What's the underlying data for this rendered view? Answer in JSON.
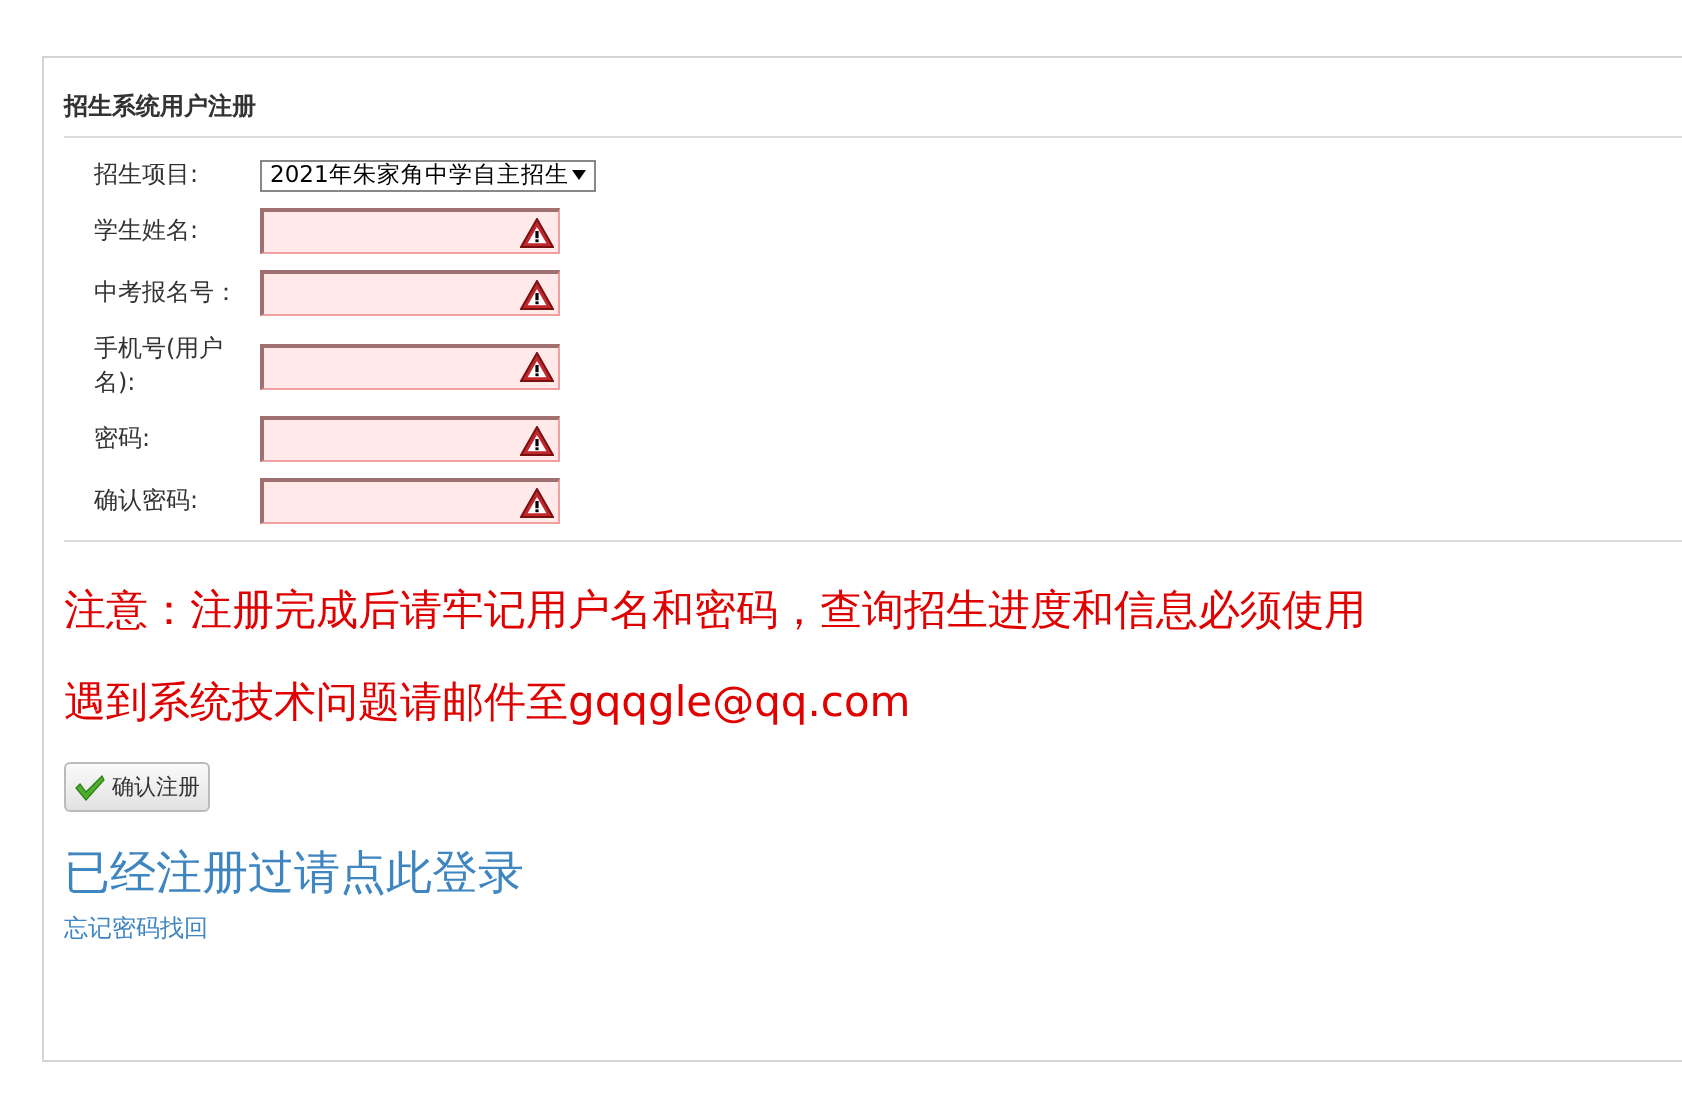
{
  "panel": {
    "title": "招生系统用户注册"
  },
  "fields": [
    {
      "label": "招生项目:",
      "kind": "select",
      "value": "2021年朱家角中学自主招生",
      "invalid": false
    },
    {
      "label": "学生姓名:",
      "kind": "text",
      "invalid": true
    },
    {
      "label": "中考报名号：",
      "kind": "text",
      "invalid": true
    },
    {
      "label": "手机号(用户名):",
      "kind": "text",
      "invalid": true
    },
    {
      "label": "密码:",
      "kind": "password",
      "invalid": true
    },
    {
      "label": "确认密码:",
      "kind": "password",
      "invalid": true
    }
  ],
  "notices": [
    "注意：注册完成后请牢记用户名和密码，查询招生进度和信息必须使用",
    "遇到系统技术问题请邮件至gqqgle@qq.com"
  ],
  "submit_button": "确认注册",
  "login_link": "已经注册过请点此登录",
  "forgot_link": "忘记密码找回"
}
